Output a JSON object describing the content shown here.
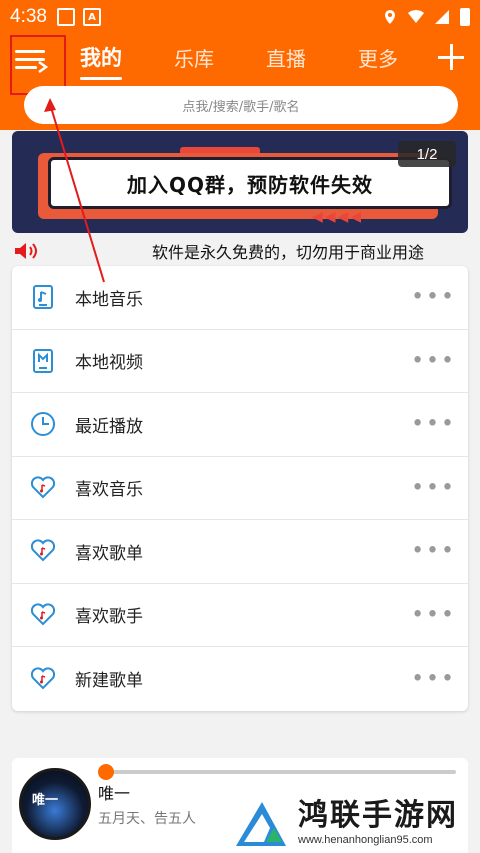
{
  "status": {
    "time": "4:38",
    "notif_a_label": "A"
  },
  "header": {
    "tabs": [
      {
        "label": "我的",
        "active": true
      },
      {
        "label": "乐库"
      },
      {
        "label": "直播"
      },
      {
        "label": "更多"
      }
    ],
    "search_placeholder": "点我/搜索/歌手/歌名"
  },
  "banner": {
    "text": "加入QQ群，预防软件失效",
    "page_indicator": "1/2"
  },
  "notice": {
    "text": "软件是永久免费的，切勿用于商业用途"
  },
  "list": [
    {
      "label": "本地音乐",
      "icon": "music-file-icon"
    },
    {
      "label": "本地视频",
      "icon": "video-file-icon"
    },
    {
      "label": "最近播放",
      "icon": "clock-icon"
    },
    {
      "label": "喜欢音乐",
      "icon": "heart-music-icon"
    },
    {
      "label": "喜欢歌单",
      "icon": "heart-music-icon"
    },
    {
      "label": "喜欢歌手",
      "icon": "heart-music-icon"
    },
    {
      "label": "新建歌单",
      "icon": "heart-music-icon"
    }
  ],
  "player": {
    "album_text": "唯一",
    "song": "唯一",
    "artist": "五月天、告五人",
    "progress": 0.0
  },
  "watermark": {
    "title": "鸿联手游网",
    "url": "www.henanhonglian95.com"
  },
  "colors": {
    "accent": "#ff6a00",
    "annotation": "#e31b1b"
  }
}
